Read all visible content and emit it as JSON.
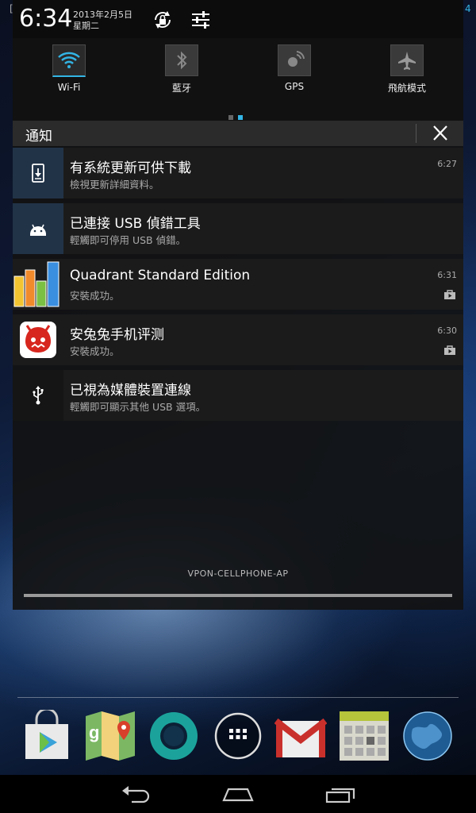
{
  "status": {
    "time": "6:34",
    "date": "2013年2月5日",
    "weekday": "星期二",
    "edge_left": "[",
    "edge_right": "4"
  },
  "quick_settings": [
    {
      "label": "Wi-Fi",
      "icon": "wifi-icon",
      "active": true
    },
    {
      "label": "藍牙",
      "icon": "bluetooth-icon",
      "active": false
    },
    {
      "label": "GPS",
      "icon": "gps-icon",
      "active": false
    },
    {
      "label": "飛航模式",
      "icon": "airplane-icon",
      "active": false
    }
  ],
  "notifications": {
    "title": "通知",
    "items": [
      {
        "title": "有系統更新可供下載",
        "text": "檢視更新詳細資料。",
        "time": "6:27",
        "icon": "system-update-icon"
      },
      {
        "title": "已連接 USB 偵錯工具",
        "text": "輕觸即可停用 USB 偵錯。",
        "time": "",
        "icon": "android-debug-icon"
      },
      {
        "title": "Quadrant Standard Edition",
        "text": "安裝成功。",
        "time": "6:31",
        "icon": "quadrant-app-icon"
      },
      {
        "title": "安兔兔手机评测",
        "text": "安裝成功。",
        "time": "6:30",
        "icon": "antutu-app-icon"
      },
      {
        "title": "已視為媒體裝置連線",
        "text": "輕觸即可顯示其他 USB 選項。",
        "time": "",
        "icon": "usb-icon"
      }
    ],
    "carrier": "VPON-CELLPHONE-AP"
  },
  "colors": {
    "accent": "#33b5e5",
    "panel": "#1b1b1b",
    "header": "#2b2b2b"
  },
  "dock": [
    "play-store-icon",
    "maps-icon",
    "chrome-icon",
    "all-apps-icon",
    "gmail-icon",
    "calendar-icon",
    "globe-icon"
  ],
  "navbar": [
    "back-icon",
    "home-icon",
    "recents-icon"
  ]
}
